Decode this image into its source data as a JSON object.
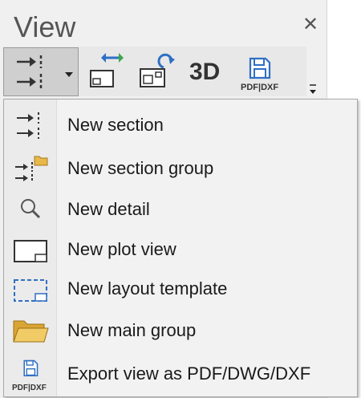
{
  "panel": {
    "title": "View",
    "close_icon": "close-icon"
  },
  "toolbar": {
    "buttons": [
      {
        "name": "new-section-split-button",
        "icon": "section-arrows-icon"
      },
      {
        "name": "swap-view-button",
        "icon": "swap-view-icon"
      },
      {
        "name": "refresh-view-button",
        "icon": "refresh-view-icon"
      },
      {
        "name": "3d-button",
        "label": "3D"
      },
      {
        "name": "export-pdf-dxf-button",
        "label": "PDF|DXF",
        "icon": "floppy-disk-icon"
      }
    ]
  },
  "menu": {
    "items": [
      {
        "label": "New section",
        "icon": "section-arrows-icon"
      },
      {
        "label": "New section group",
        "icon": "section-group-icon"
      },
      {
        "label": "New detail",
        "icon": "magnifier-icon"
      },
      {
        "label": "New plot view",
        "icon": "plot-view-icon"
      },
      {
        "label": "New layout template",
        "icon": "layout-template-icon"
      },
      {
        "label": "New main group",
        "icon": "folder-icon"
      },
      {
        "label": "Export view as PDF/DWG/DXF",
        "icon": "floppy-disk-icon",
        "icon_caption": "PDF|DXF"
      }
    ]
  },
  "colors": {
    "accent_blue": "#2f6fc4",
    "folder_yellow": "#e8b84a",
    "icon_dark": "#333333"
  }
}
